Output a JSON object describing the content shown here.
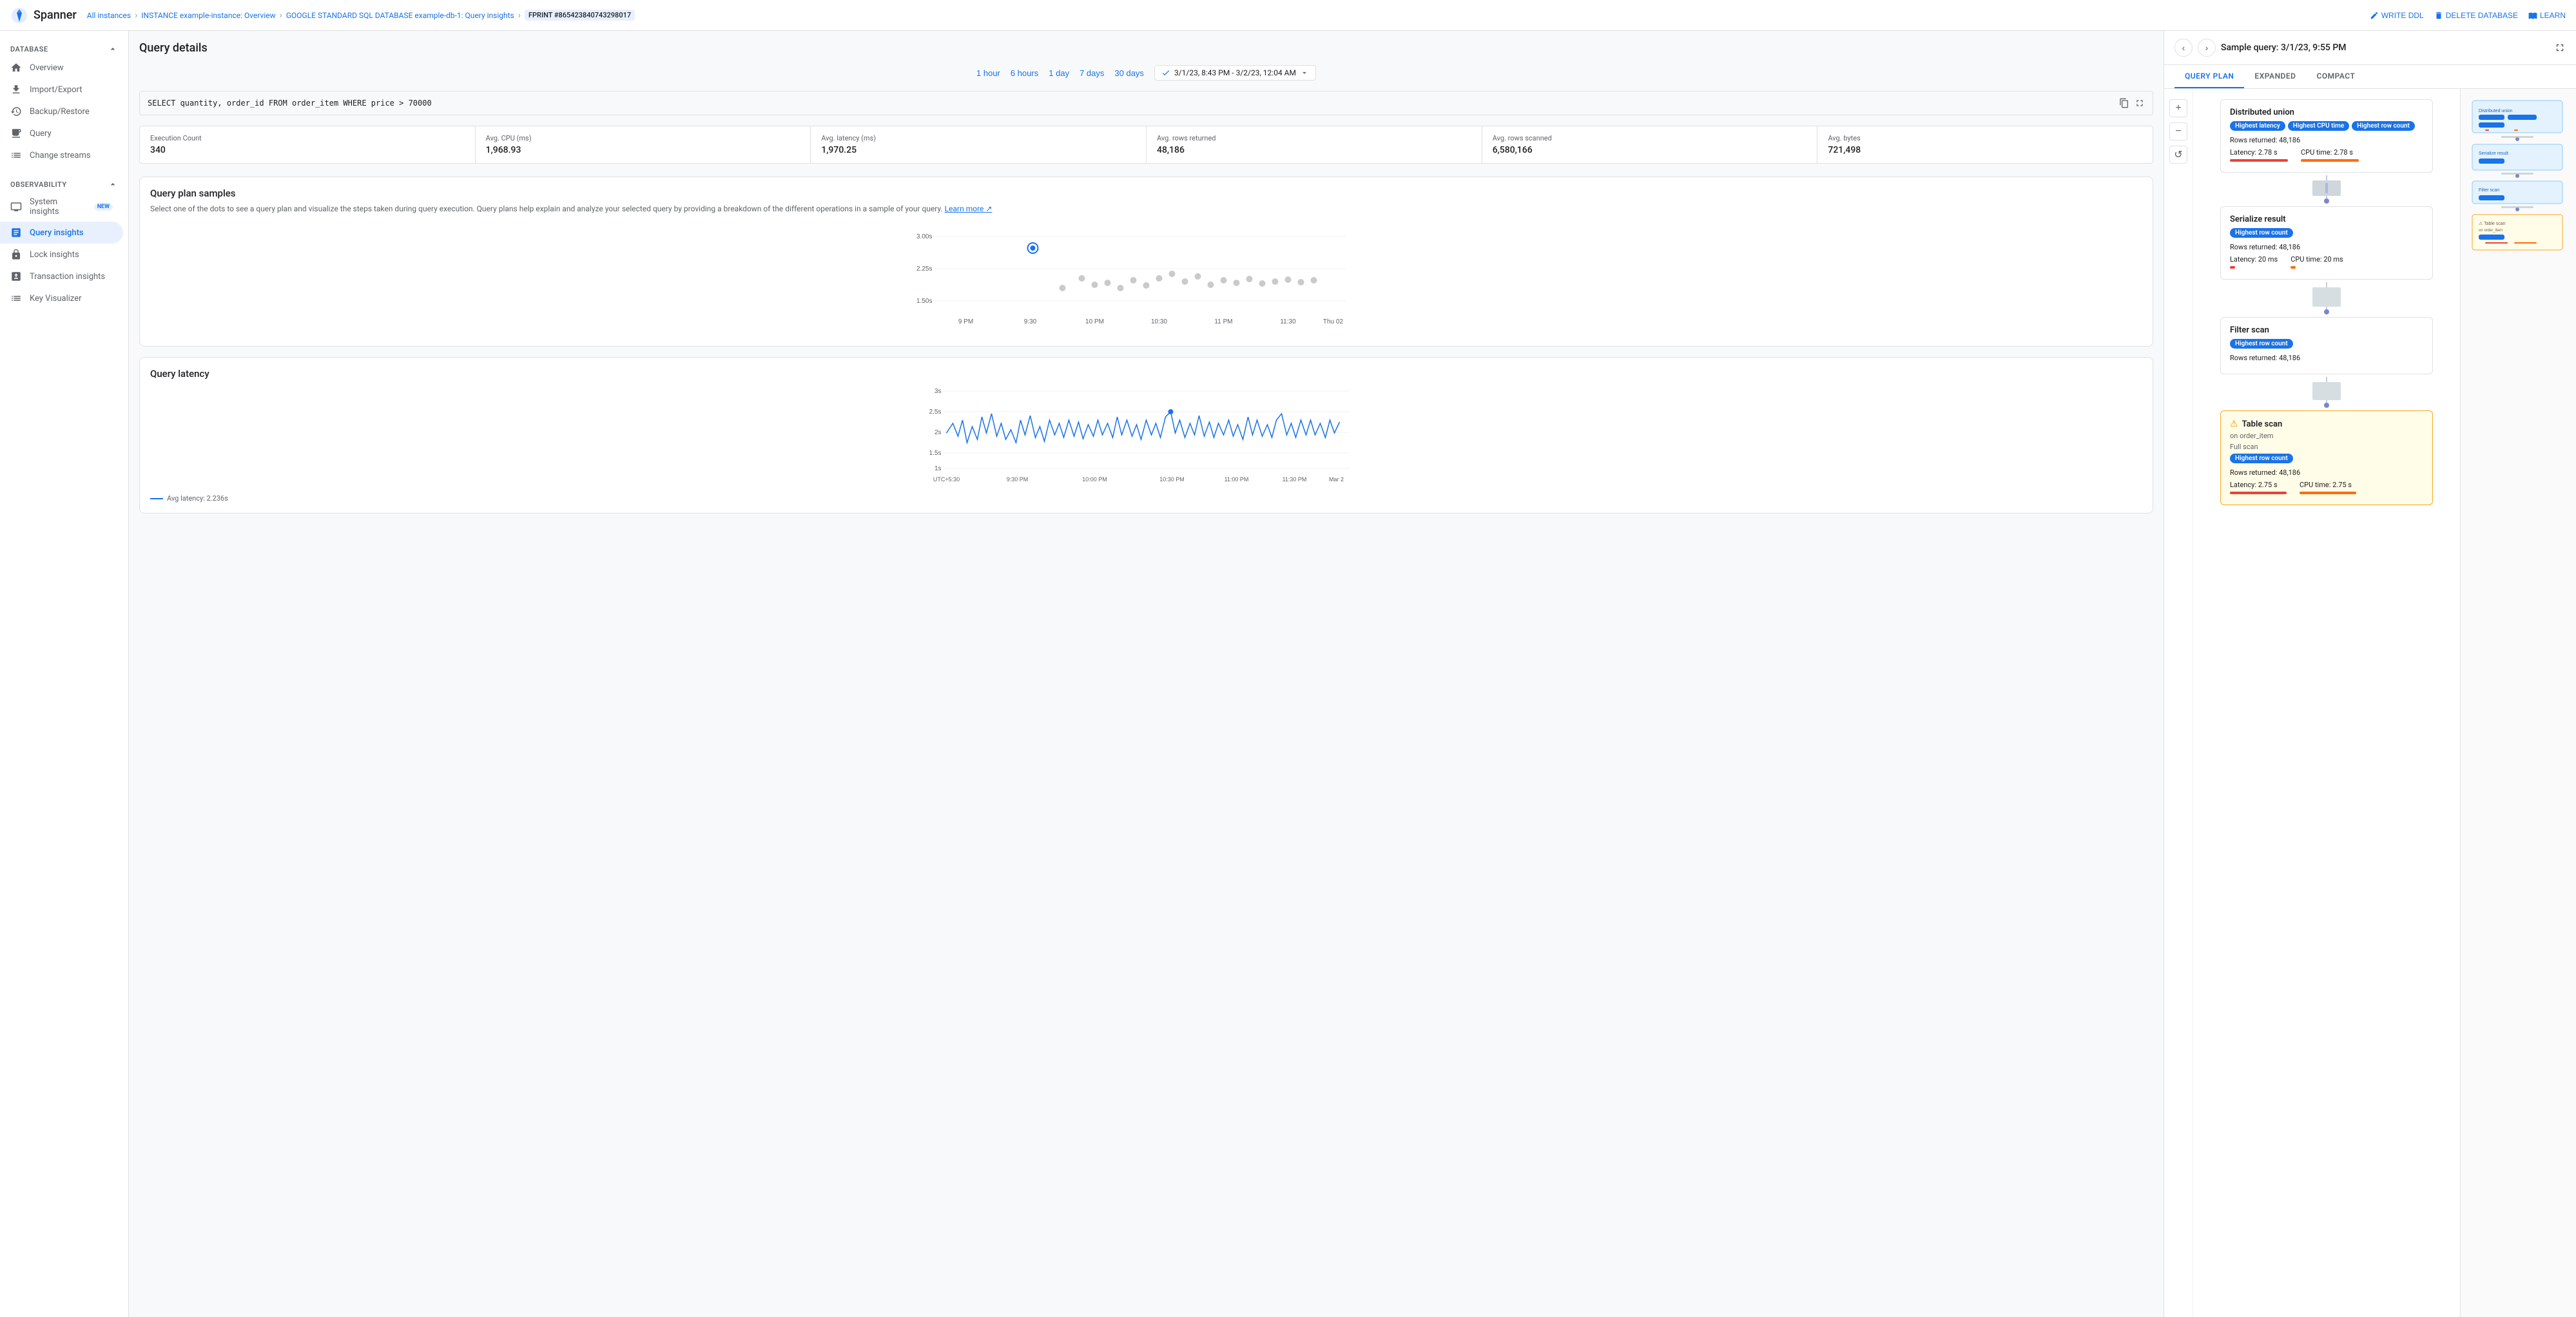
{
  "topbar": {
    "app_name": "Spanner",
    "breadcrumb": [
      {
        "label": "All instances",
        "link": true
      },
      {
        "label": "INSTANCE example-instance: Overview",
        "link": true
      },
      {
        "label": "GOOGLE STANDARD SQL DATABASE example-db-1: Query insights",
        "link": true
      },
      {
        "label": "FPRINT #865423840743298017",
        "link": false,
        "badge": true
      }
    ],
    "actions": [
      {
        "label": "WRITE DDL",
        "icon": "edit-icon"
      },
      {
        "label": "DELETE DATABASE",
        "icon": "delete-icon"
      },
      {
        "label": "LEARN",
        "icon": "book-icon"
      }
    ]
  },
  "sidebar": {
    "database_section": "DATABASE",
    "database_items": [
      {
        "label": "Overview",
        "icon": "home-icon",
        "active": false
      },
      {
        "label": "Import/Export",
        "icon": "import-icon",
        "active": false
      },
      {
        "label": "Backup/Restore",
        "icon": "backup-icon",
        "active": false
      },
      {
        "label": "Query",
        "icon": "query-icon",
        "active": false
      },
      {
        "label": "Change streams",
        "icon": "streams-icon",
        "active": false
      }
    ],
    "observability_section": "OBSERVABILITY",
    "observability_items": [
      {
        "label": "System insights",
        "icon": "monitor-icon",
        "active": false,
        "badge": "NEW"
      },
      {
        "label": "Query insights",
        "icon": "insights-icon",
        "active": true
      },
      {
        "label": "Lock insights",
        "icon": "lock-icon",
        "active": false
      },
      {
        "label": "Transaction insights",
        "icon": "transaction-icon",
        "active": false
      },
      {
        "label": "Key Visualizer",
        "icon": "key-icon",
        "active": false
      }
    ]
  },
  "query_details": {
    "title": "Query details",
    "time_filters": [
      "1 hour",
      "6 hours",
      "1 day",
      "7 days",
      "30 days"
    ],
    "date_range": "3/1/23, 8:43 PM - 3/2/23, 12:04 AM",
    "query": "SELECT quantity, order_id FROM order_item WHERE price > 70000",
    "stats": [
      {
        "label": "Execution Count",
        "value": "340"
      },
      {
        "label": "Avg. CPU (ms)",
        "value": "1,968.93"
      },
      {
        "label": "Avg. latency (ms)",
        "value": "1,970.25"
      },
      {
        "label": "Avg. rows returned",
        "value": "48,186"
      },
      {
        "label": "Avg. rows scanned",
        "value": "6,580,166"
      },
      {
        "label": "Avg. bytes",
        "value": "721,498"
      }
    ]
  },
  "query_plan_samples": {
    "title": "Query plan samples",
    "description": "Select one of the dots to see a query plan and visualize the steps taken during query execution. Query plans help explain and analyze your selected query by providing a breakdown of the different operations in a sample of your query.",
    "learn_more": "Learn more",
    "x_labels": [
      "9 PM",
      "9:30",
      "10 PM",
      "10:30",
      "11 PM",
      "11:30",
      "Thu 02"
    ],
    "y_labels": [
      "3.00s",
      "2.25s",
      "1.50s"
    ],
    "dots": [
      {
        "x": 0.25,
        "y": 0.18,
        "selected": true
      },
      {
        "x": 0.35,
        "y": 0.38
      },
      {
        "x": 0.28,
        "y": 0.55
      },
      {
        "x": 0.37,
        "y": 0.52
      },
      {
        "x": 0.42,
        "y": 0.58
      },
      {
        "x": 0.45,
        "y": 0.65
      },
      {
        "x": 0.52,
        "y": 0.45
      },
      {
        "x": 0.55,
        "y": 0.42
      },
      {
        "x": 0.58,
        "y": 0.48
      },
      {
        "x": 0.6,
        "y": 0.38
      },
      {
        "x": 0.63,
        "y": 0.62
      },
      {
        "x": 0.65,
        "y": 0.4
      },
      {
        "x": 0.68,
        "y": 0.38
      },
      {
        "x": 0.7,
        "y": 0.48
      },
      {
        "x": 0.72,
        "y": 0.55
      },
      {
        "x": 0.75,
        "y": 0.52
      },
      {
        "x": 0.78,
        "y": 0.6
      },
      {
        "x": 0.82,
        "y": 0.52
      },
      {
        "x": 0.85,
        "y": 0.55
      },
      {
        "x": 0.9,
        "y": 0.55
      }
    ]
  },
  "query_latency": {
    "title": "Query latency",
    "y_labels": [
      "3s",
      "2.5s",
      "2s",
      "1.5s",
      "1s"
    ],
    "x_labels": [
      "UTC+5:30",
      "9:30 PM",
      "10:00 PM",
      "10:30 PM",
      "11:00 PM",
      "11:30 PM",
      "Mar 2"
    ],
    "legend": "Avg latency: 2.236s"
  },
  "right_panel": {
    "title": "Sample query: 3/1/23, 9:55 PM",
    "tabs": [
      "QUERY PLAN",
      "EXPANDED",
      "COMPACT"
    ],
    "active_tab": "QUERY PLAN",
    "plan_nodes": [
      {
        "title": "Distributed union",
        "badges": [
          "Highest latency",
          "Highest CPU time",
          "Highest row count"
        ],
        "rows_returned": "Rows returned: 48,186",
        "latency": "Latency: 2.78 s",
        "cpu_time": "CPU time: 2.78 s",
        "latency_bar_width": 90,
        "cpu_bar_width": 90
      },
      {
        "title": "Serialize result",
        "badges": [
          "Highest row count"
        ],
        "rows_returned": "Rows returned: 48,186",
        "latency": "Latency: 20 ms",
        "cpu_time": "CPU time: 20 ms",
        "latency_bar_width": 8,
        "cpu_bar_width": 8
      },
      {
        "title": "Filter scan",
        "badges": [
          "Highest row count"
        ],
        "rows_returned": "Rows returned: 48,186",
        "latency": null,
        "cpu_time": null,
        "latency_bar_width": 0,
        "cpu_bar_width": 0
      },
      {
        "title": "Table scan",
        "subtitle": "on order_item",
        "detail": "Full scan",
        "warning": true,
        "badges": [
          "Highest row count"
        ],
        "rows_returned": "Rows returned: 48,186",
        "latency": "Latency: 2.75 s",
        "cpu_time": "CPU time: 2.75 s",
        "latency_bar_width": 88,
        "cpu_bar_width": 88
      }
    ],
    "badge_labels": {
      "Highest latency": "latency",
      "Highest CPU time": "cpu",
      "Highest row count": "row"
    }
  }
}
